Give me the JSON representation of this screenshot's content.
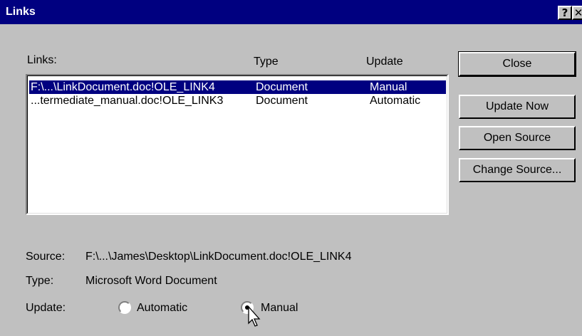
{
  "window": {
    "title": "Links",
    "help_glyph": "?",
    "close_glyph": "✕"
  },
  "list": {
    "headers": {
      "links": "Links:",
      "type": "Type",
      "update": "Update"
    },
    "rows": [
      {
        "link": "F:\\...\\LinkDocument.doc!OLE_LINK4",
        "type": "Document",
        "update": "Manual",
        "selected": true
      },
      {
        "link": "...termediate_manual.doc!OLE_LINK3",
        "type": "Document",
        "update": "Automatic",
        "selected": false
      }
    ]
  },
  "buttons": {
    "close": "Close",
    "update_now": "Update Now",
    "open_source": "Open Source",
    "change_source": "Change Source..."
  },
  "details": {
    "source_label": "Source:",
    "source_value": "F:\\...\\James\\Desktop\\LinkDocument.doc!OLE_LINK4",
    "type_label": "Type:",
    "type_value": "Microsoft Word Document",
    "update_label": "Update:",
    "automatic_label": "Automatic",
    "manual_label": "Manual",
    "selected_update": "Manual"
  },
  "colors": {
    "face": "#c0c0c0",
    "titlebar": "#000080",
    "selection": "#000080"
  },
  "icons": {
    "cursor": "arrow-pointer-icon"
  }
}
